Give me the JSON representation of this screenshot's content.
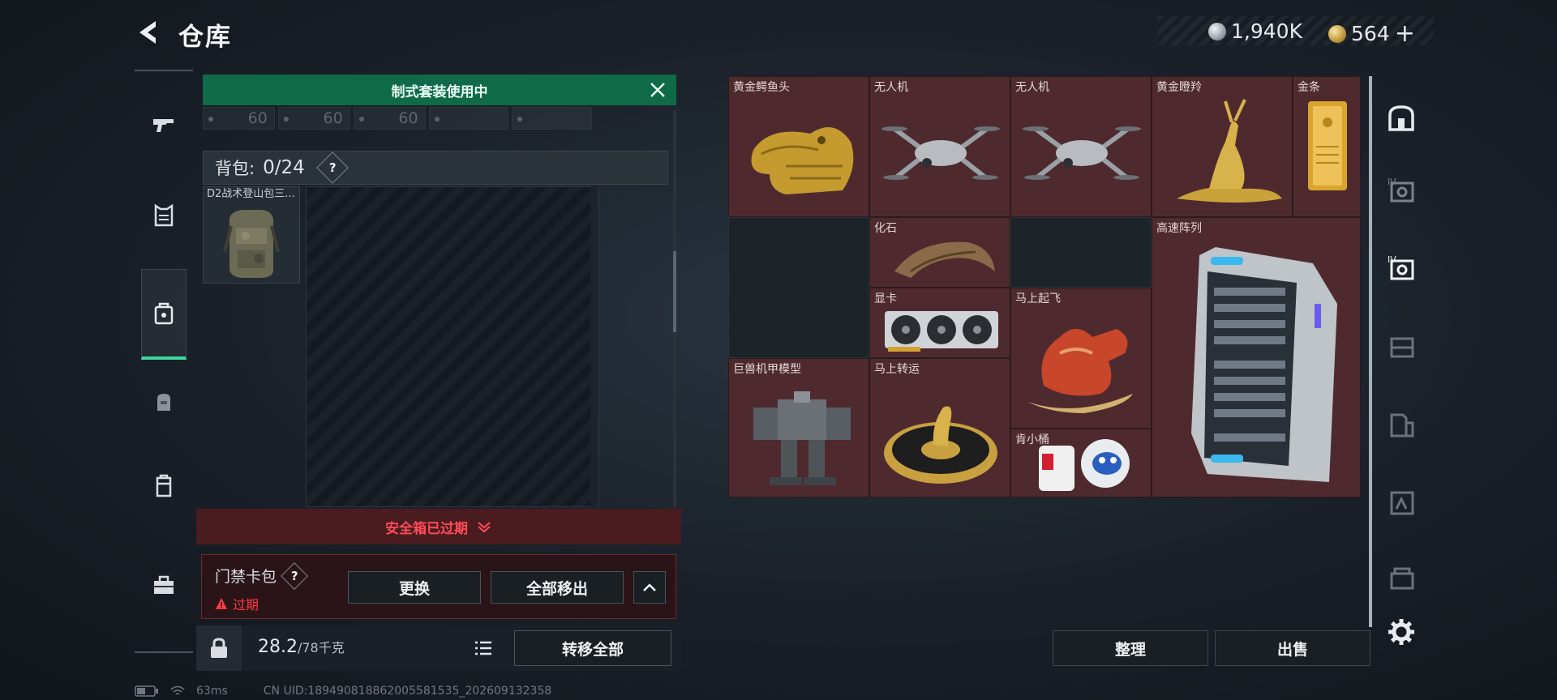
{
  "header": {
    "title": "仓库",
    "currency_silver": "1,940K",
    "currency_gold": "564",
    "currency_add": "+"
  },
  "left_panel": {
    "kit_banner": "制式套装使用中",
    "ammo_slots": [
      "60",
      "60",
      "60"
    ],
    "backpack_label": "背包:",
    "backpack_count": "0/24",
    "help_mark": "?",
    "bag_item_label": "D2战术登山包三...",
    "safebox_text": "安全箱已过期",
    "keycard_title": "门禁卡包",
    "keycard_status": "过期",
    "replace_btn": "更换",
    "remove_all_btn": "全部移出",
    "weight_value": "28.2",
    "weight_max": "/78千克",
    "transfer_all_btn": "转移全部"
  },
  "stash": {
    "items": [
      {
        "label": "黄金鳄鱼头",
        "icon": "gold-croc-head"
      },
      {
        "label": "无人机",
        "icon": "drone"
      },
      {
        "label": "无人机",
        "icon": "drone"
      },
      {
        "label": "黄金瞪羚",
        "icon": "gold-gazelle"
      },
      {
        "label": "金条",
        "icon": "gold-bar"
      },
      {
        "label": "化石",
        "icon": "fossil-claw"
      },
      {
        "label": "高速阵列",
        "icon": "server-array"
      },
      {
        "label": "显卡",
        "icon": "graphics-card"
      },
      {
        "label": "马上起飞",
        "icon": "red-horse"
      },
      {
        "label": "巨兽机甲模型",
        "icon": "mech-model"
      },
      {
        "label": "马上转运",
        "icon": "horse-coin"
      },
      {
        "label": "肯小桶",
        "icon": "astronaut-bucket"
      }
    ],
    "sort_btn": "整理",
    "sell_btn": "出售"
  },
  "status": {
    "ping": "63ms",
    "uid": "CN UID:18949081886200558153​5_202609132358"
  },
  "colors": {
    "accent_green": "#3ed6a0",
    "kit_green": "#0f6a48",
    "warning_red": "#ff4b58",
    "stash_cell": "#4e2a2f"
  }
}
